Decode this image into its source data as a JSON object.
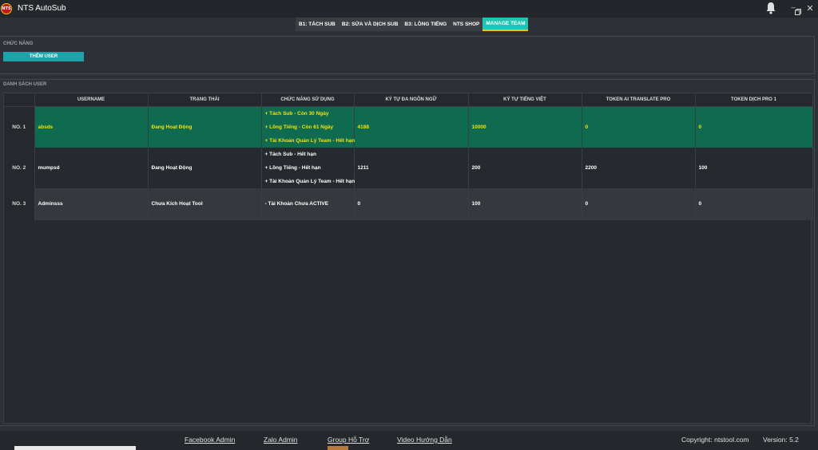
{
  "window": {
    "logo_text": "NTS",
    "title": "NTS AutoSub",
    "icons": [
      "bell-icon",
      "minimize-icon",
      "maximize-icon",
      "close-icon"
    ]
  },
  "tabs": [
    {
      "label": "B1: TÁCH SUB",
      "active": false
    },
    {
      "label": "B2: SỬA VÀ DỊCH SUB",
      "active": false
    },
    {
      "label": "B3: LỒNG TIẾNG",
      "active": false
    },
    {
      "label": "NTS SHOP",
      "active": false
    },
    {
      "label": "MANAGE TEAM",
      "active": true
    }
  ],
  "functions": {
    "section_label": "CHỨC NĂNG",
    "add_user_label": "THÊM USER"
  },
  "users": {
    "section_label": "DANH SÁCH USER",
    "columns": [
      "USERNAME",
      "TRẠNG THÁI",
      "CHỨC NĂNG SỬ DỤNG",
      "KÝ TỰ ĐA NGÔN NGỮ",
      "KÝ TỰ TIẾNG VIỆT",
      "TOKEN AI TRANSLATE PRO",
      "TOKEN DỊCH PRO 1"
    ],
    "rows": [
      {
        "no": "NO. 1",
        "username": "absds",
        "status": "Đang Hoạt Động",
        "features": [
          "+ Tách Sub - Còn 30 Ngày",
          "+ Lồng Tiếng - Còn 61 Ngày",
          "+ Tài Khoản Quản Lý Team - Hết hạn"
        ],
        "multi_chars": "4188",
        "vi_chars": "10000",
        "ai_token": "0",
        "pro1_token": "0"
      },
      {
        "no": "NO. 2",
        "username": "mumpsd",
        "status": "Đang Hoạt Động",
        "features": [
          "+ Tách Sub - Hết hạn",
          "+ Lồng Tiếng - Hết hạn",
          "+ Tài Khoản Quản Lý Team - Hết hạn"
        ],
        "multi_chars": "1211",
        "vi_chars": "200",
        "ai_token": "2200",
        "pro1_token": "100"
      },
      {
        "no": "NO. 3",
        "username": "Adminsss",
        "status": "Chưa Kích Hoạt Tool",
        "features": [
          "- Tài Khoản Chưa ACTIVE"
        ],
        "multi_chars": "0",
        "vi_chars": "100",
        "ai_token": "0",
        "pro1_token": "0"
      }
    ]
  },
  "footer": {
    "facebook": "Facebook Admin",
    "zalo": "Zalo Admin",
    "group": "Group Hỗ Trợ",
    "video": "Video Hướng Dẫn",
    "copyright": "Copyright: ntstool.com",
    "version": "Version: 5.2"
  },
  "colors": {
    "accent_tab": "#1fc5b0",
    "active_row": "#0e6b4f",
    "active_row_text": "#f3e10c",
    "add_button": "#1ea3aa"
  }
}
